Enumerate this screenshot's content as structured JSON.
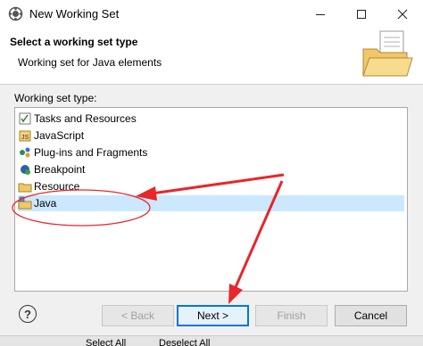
{
  "window": {
    "title": "New Working Set"
  },
  "header": {
    "title": "Select a working set type",
    "description": "Working set for Java elements"
  },
  "list": {
    "label": "Working set type:",
    "items": [
      {
        "label": "Tasks and Resources",
        "icon": "tasks-icon"
      },
      {
        "label": "JavaScript",
        "icon": "javascript-icon"
      },
      {
        "label": "Plug-ins and Fragments",
        "icon": "plugin-icon"
      },
      {
        "label": "Breakpoint",
        "icon": "breakpoint-icon"
      },
      {
        "label": "Resource",
        "icon": "resource-icon"
      },
      {
        "label": "Java",
        "icon": "java-icon",
        "selected": true
      }
    ]
  },
  "buttons": {
    "help": "?",
    "back": "< Back",
    "next": "Next >",
    "finish": "Finish",
    "cancel": "Cancel"
  },
  "background_buttons": {
    "select_all": "Select All",
    "deselect_all": "Deselect All"
  },
  "colors": {
    "selection": "#cce8ff",
    "annotation_red": "#e8262b",
    "default_button_border": "#0078d7"
  }
}
